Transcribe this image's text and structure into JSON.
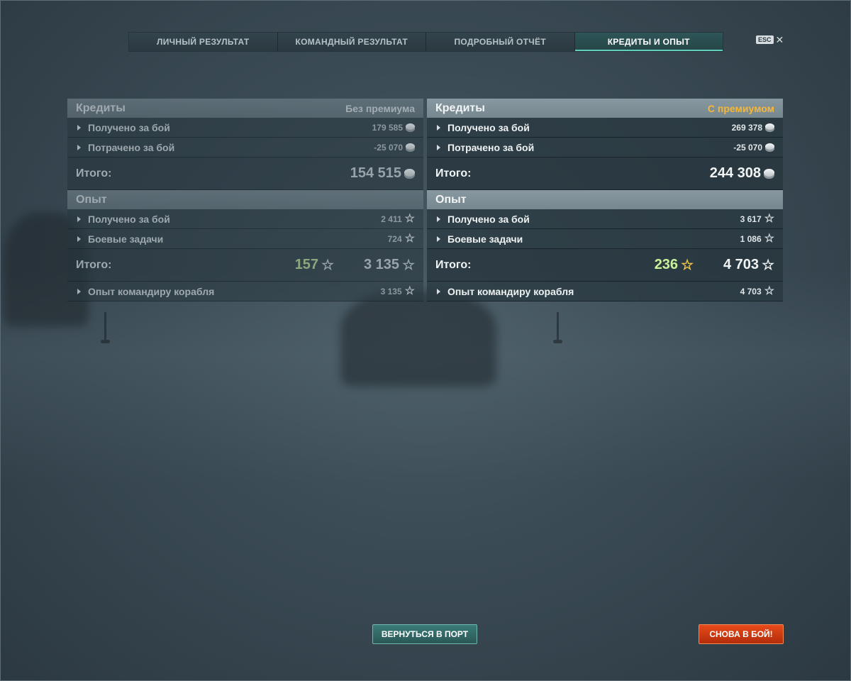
{
  "tabs": [
    {
      "label": "ЛИЧНЫЙ РЕЗУЛЬТАТ",
      "active": false
    },
    {
      "label": "КОМАНДНЫЙ РЕЗУЛЬТАТ",
      "active": false
    },
    {
      "label": "ПОДРОБНЫЙ ОТЧЁТ",
      "active": false
    },
    {
      "label": "КРЕДИТЫ И ОПЫТ",
      "active": true
    }
  ],
  "close": {
    "key": "ESC",
    "icon": "close-icon"
  },
  "no_premium": {
    "credits": {
      "title": "Кредиты",
      "subtitle": "Без премиума",
      "earned_label": "Получено за бой",
      "earned_value": "179 585",
      "spent_label": "Потрачено за бой",
      "spent_value": "-25 070",
      "total_label": "Итого:",
      "total_value": "154 515"
    },
    "experience": {
      "title": "Опыт",
      "earned_label": "Получено за бой",
      "earned_value": "2 411",
      "tasks_label": "Боевые задачи",
      "tasks_value": "724",
      "total_label": "Итого:",
      "free_xp": "157",
      "total_value": "3 135",
      "commander_label": "Опыт командиру корабля",
      "commander_value": "3 135"
    }
  },
  "premium": {
    "credits": {
      "title": "Кредиты",
      "subtitle": "С премиумом",
      "earned_label": "Получено за бой",
      "earned_value": "269 378",
      "spent_label": "Потрачено за бой",
      "spent_value": "-25 070",
      "total_label": "Итого:",
      "total_value": "244 308"
    },
    "experience": {
      "title": "Опыт",
      "earned_label": "Получено за бой",
      "earned_value": "3 617",
      "tasks_label": "Боевые задачи",
      "tasks_value": "1 086",
      "total_label": "Итого:",
      "free_xp": "236",
      "total_value": "4 703",
      "commander_label": "Опыт командиру корабля",
      "commander_value": "4 703"
    }
  },
  "buttons": {
    "return_port": "ВЕРНУТЬСЯ В ПОРТ",
    "battle_again": "СНОВА В БОЙ!"
  },
  "colors": {
    "premium_accent": "#f5b73a",
    "free_xp": "#c9f19a",
    "active_tab": "#5fcfbb",
    "battle_button": "#e84a1a",
    "port_button": "#3b7b78"
  }
}
